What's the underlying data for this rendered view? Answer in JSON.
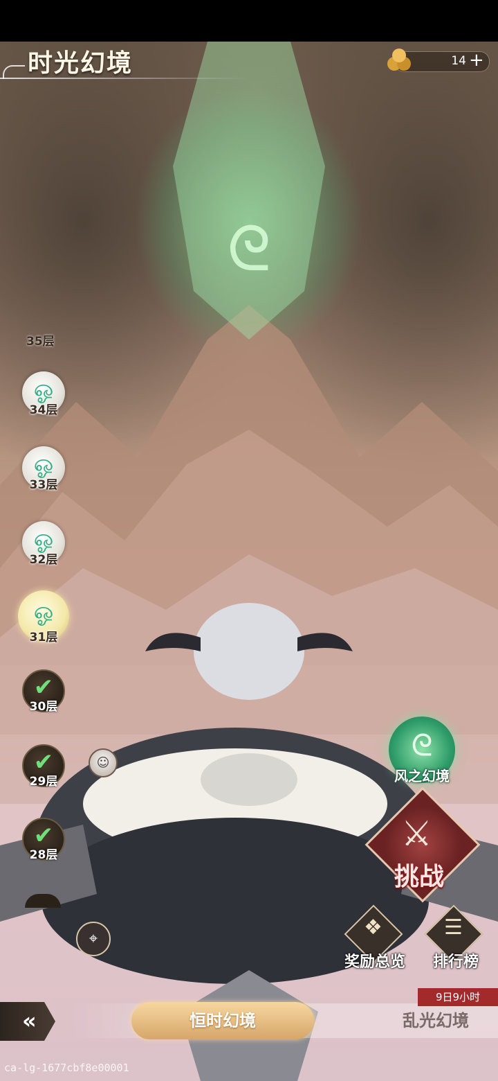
{
  "header": {
    "title": "时光幻境",
    "currency": {
      "icon": "gold-ore-icon",
      "value": "14",
      "add_label": "+"
    }
  },
  "floors": [
    {
      "label": "35层",
      "state": "future"
    },
    {
      "label": "34层",
      "state": "future",
      "icon": "wind-cloud-icon"
    },
    {
      "label": "33层",
      "state": "future",
      "icon": "wind-cloud-icon"
    },
    {
      "label": "32层",
      "state": "future",
      "icon": "wind-cloud-icon"
    },
    {
      "label": "31层",
      "state": "current",
      "icon": "wind-cloud-icon"
    },
    {
      "label": "30层",
      "state": "cleared",
      "icon": "check-icon"
    },
    {
      "label": "29层",
      "state": "cleared",
      "icon": "check-icon"
    },
    {
      "label": "28层",
      "state": "cleared",
      "icon": "check-icon"
    }
  ],
  "realm": {
    "label": "风之幻境",
    "icon": "wind-rune-icon"
  },
  "actions": {
    "challenge": "挑战",
    "rewards": "奖励总览",
    "ranking": "排行榜"
  },
  "tabs": [
    {
      "label": "恒时幻境",
      "active": true
    },
    {
      "label": "乱光幻境",
      "active": false
    }
  ],
  "timer": "9日9小时",
  "watermark": "ca-lg-1677cbf8e00001",
  "colors": {
    "accent_green": "#2fae86",
    "challenge_red": "#a24242",
    "tab_gold": "#d6a66a",
    "timer_red": "#a22a2a"
  }
}
